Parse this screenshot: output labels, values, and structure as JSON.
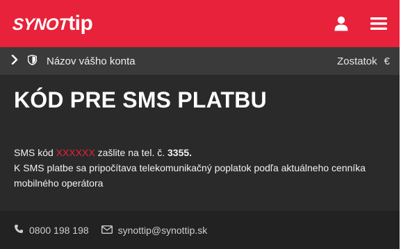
{
  "header": {
    "logo_part1": "SYNOT",
    "logo_part2": "tip",
    "colors": {
      "brand_red": "#e8223a",
      "header_text": "#ffffff"
    },
    "icons": [
      "user-icon",
      "hamburger-menu-icon"
    ]
  },
  "account_bar": {
    "account_name": "Názov vášho konta",
    "balance_label": "Zostatok",
    "currency_symbol": "€",
    "icons": [
      "chevron-right-icon",
      "shield-icon"
    ]
  },
  "main": {
    "title": "KÓD PRE SMS PLATBU",
    "line1_prefix": "SMS kód ",
    "sms_code": "XXXXXX",
    "line1_middle": " zašlite na tel. č. ",
    "sms_number": "3355.",
    "line2": "K SMS platbe sa pripočítava telekomunikačný poplatok podľa aktuálneho cenníka mobilného operátora"
  },
  "footer": {
    "phone": "0800 198 198",
    "email": "synottip@synottip.sk",
    "icons": [
      "phone-icon",
      "envelope-icon"
    ]
  }
}
